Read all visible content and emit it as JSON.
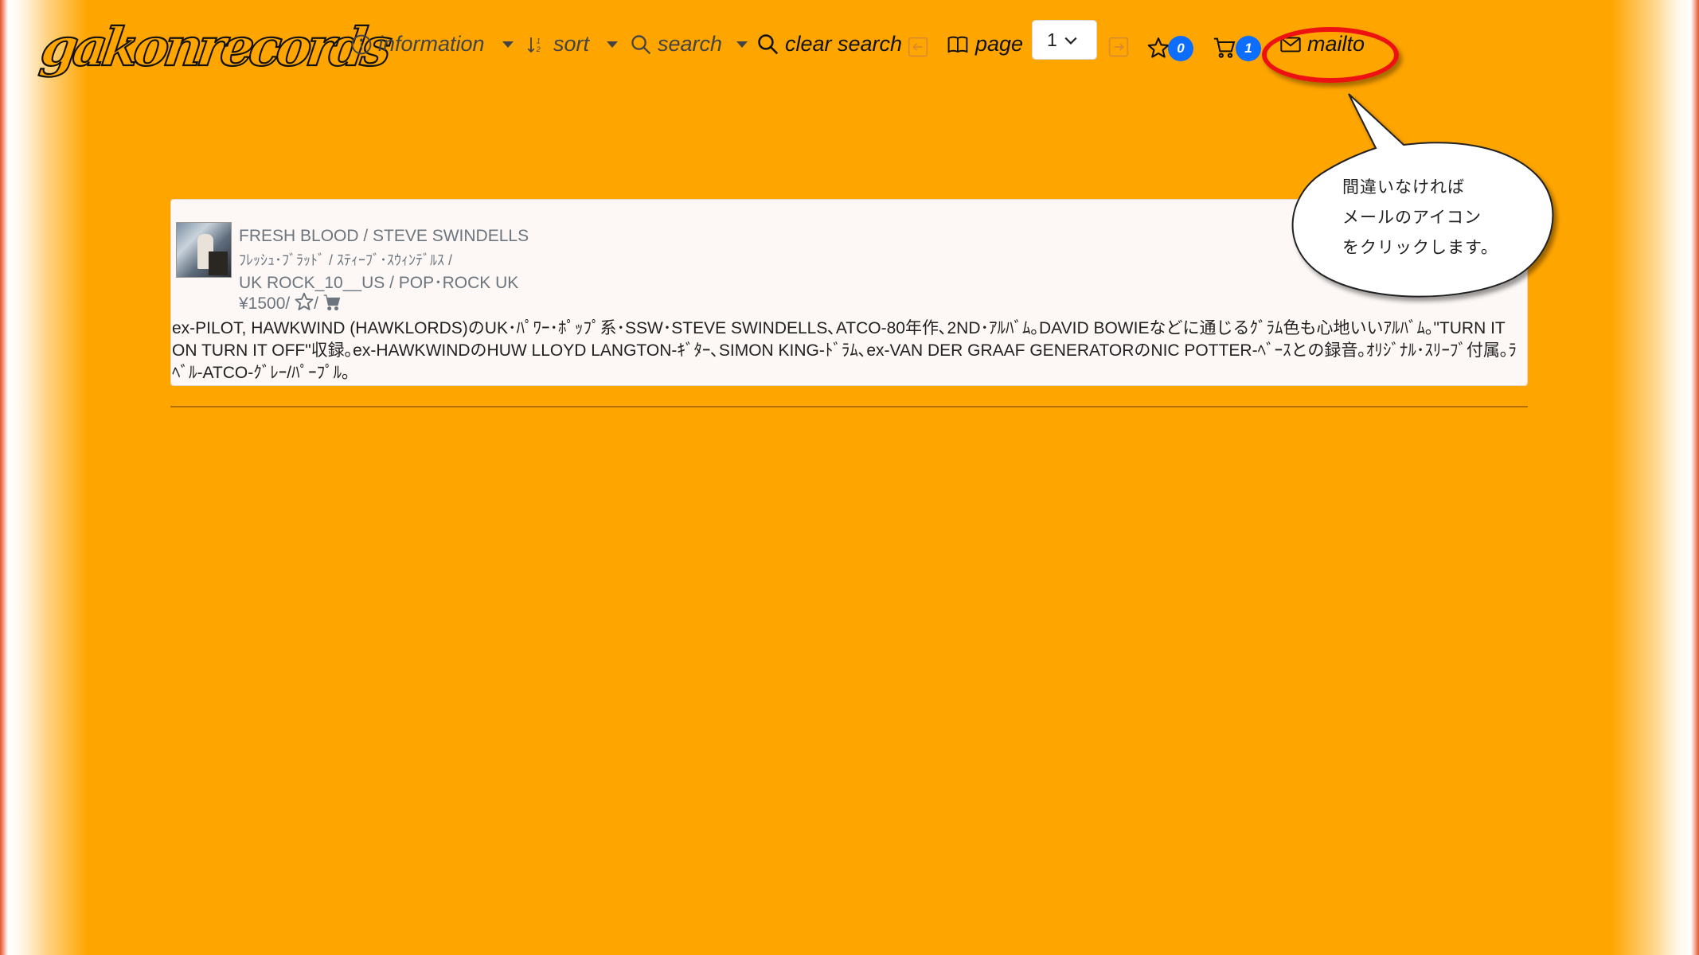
{
  "logo": {
    "text": "gakonrecords"
  },
  "nav": {
    "information": "information",
    "sort": "sort",
    "search": "search",
    "clear_search": "clear search",
    "page_label": "page",
    "page_value": "1",
    "favorites_count": "0",
    "cart_count": "1",
    "mailto": "mailto"
  },
  "item": {
    "title": "FRESH BLOOD / STEVE SWINDELLS",
    "kana": "ﾌﾚｯｼｭ･ﾌﾞﾗｯﾄﾞ / ｽﾃｨｰﾌﾞ･ｽｳｨﾝﾃﾞﾙｽ /",
    "category": "UK ROCK_10__US / POP･ROCK UK",
    "price": "¥1500/",
    "price_sep": "/",
    "description": "ex-PILOT, HAWKWIND (HAWKLORDS)のUK･ﾊﾟﾜｰ･ﾎﾟｯﾌﾟ系･SSW･STEVE SWINDELLS､ATCO-80年作､2ND･ｱﾙﾊﾞﾑ｡DAVID BOWIEなどに通じるｸﾞﾗﾑ色も心地いいｱﾙﾊﾞﾑ｡\"TURN IT ON TURN IT OFF\"収録｡ex-HAWKWINDのHUW LLOYD LANGTON-ｷﾞﾀｰ､SIMON KING-ﾄﾞﾗﾑ､ex-VAN DER GRAAF GENERATORのNIC POTTER-ﾍﾞｰｽとの録音｡ｵﾘｼﾞﾅﾙ･ｽﾘｰﾌﾞ付属｡ﾗﾍﾞﾙ-ATCO-ｸﾞﾚｰ/ﾊﾟｰﾌﾟﾙ｡"
  },
  "callout": {
    "line1": "間違いなければ",
    "line2": "メールのアイコン",
    "line3": "をクリックします。"
  },
  "colors": {
    "background": "#FFA500",
    "badge": "#0d6efd",
    "highlight": "#ee1111"
  },
  "icons": [
    "info-circle-icon",
    "sort-icon",
    "search-icon",
    "arrow-left-square-icon",
    "book-icon",
    "chevron-down-icon",
    "arrow-right-square-icon",
    "star-icon",
    "cart-icon",
    "envelope-icon"
  ]
}
